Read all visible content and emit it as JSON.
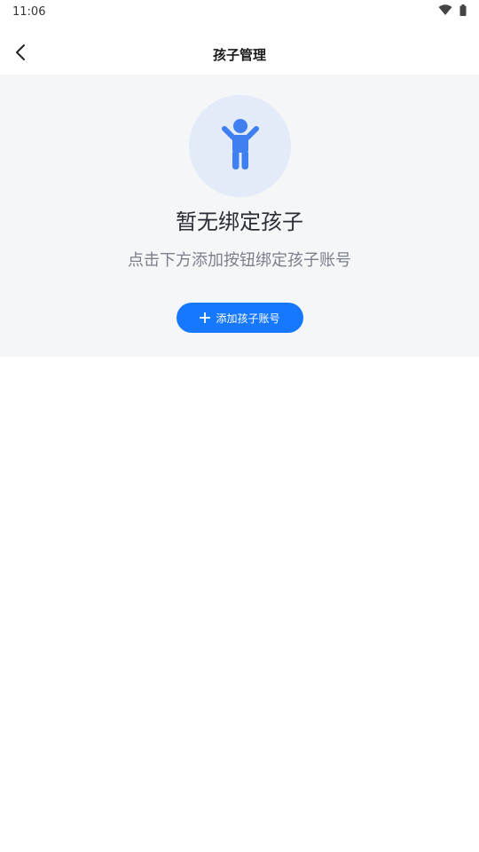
{
  "status_bar": {
    "time": "11:06",
    "icons": [
      "wifi-icon",
      "battery-icon"
    ]
  },
  "nav": {
    "title": "孩子管理",
    "back_icon": "chevron-left-icon"
  },
  "empty_state": {
    "illustration_icon": "child-icon",
    "title": "暂无绑定孩子",
    "subtitle": "点击下方添加按钮绑定孩子账号",
    "button_label": "添加孩子账号",
    "button_icon": "plus-icon"
  },
  "colors": {
    "accent": "#1677ff",
    "panel_bg": "#f5f6f8",
    "avatar_bg": "#e3ebf9",
    "child_icon": "#3f7ff0"
  }
}
